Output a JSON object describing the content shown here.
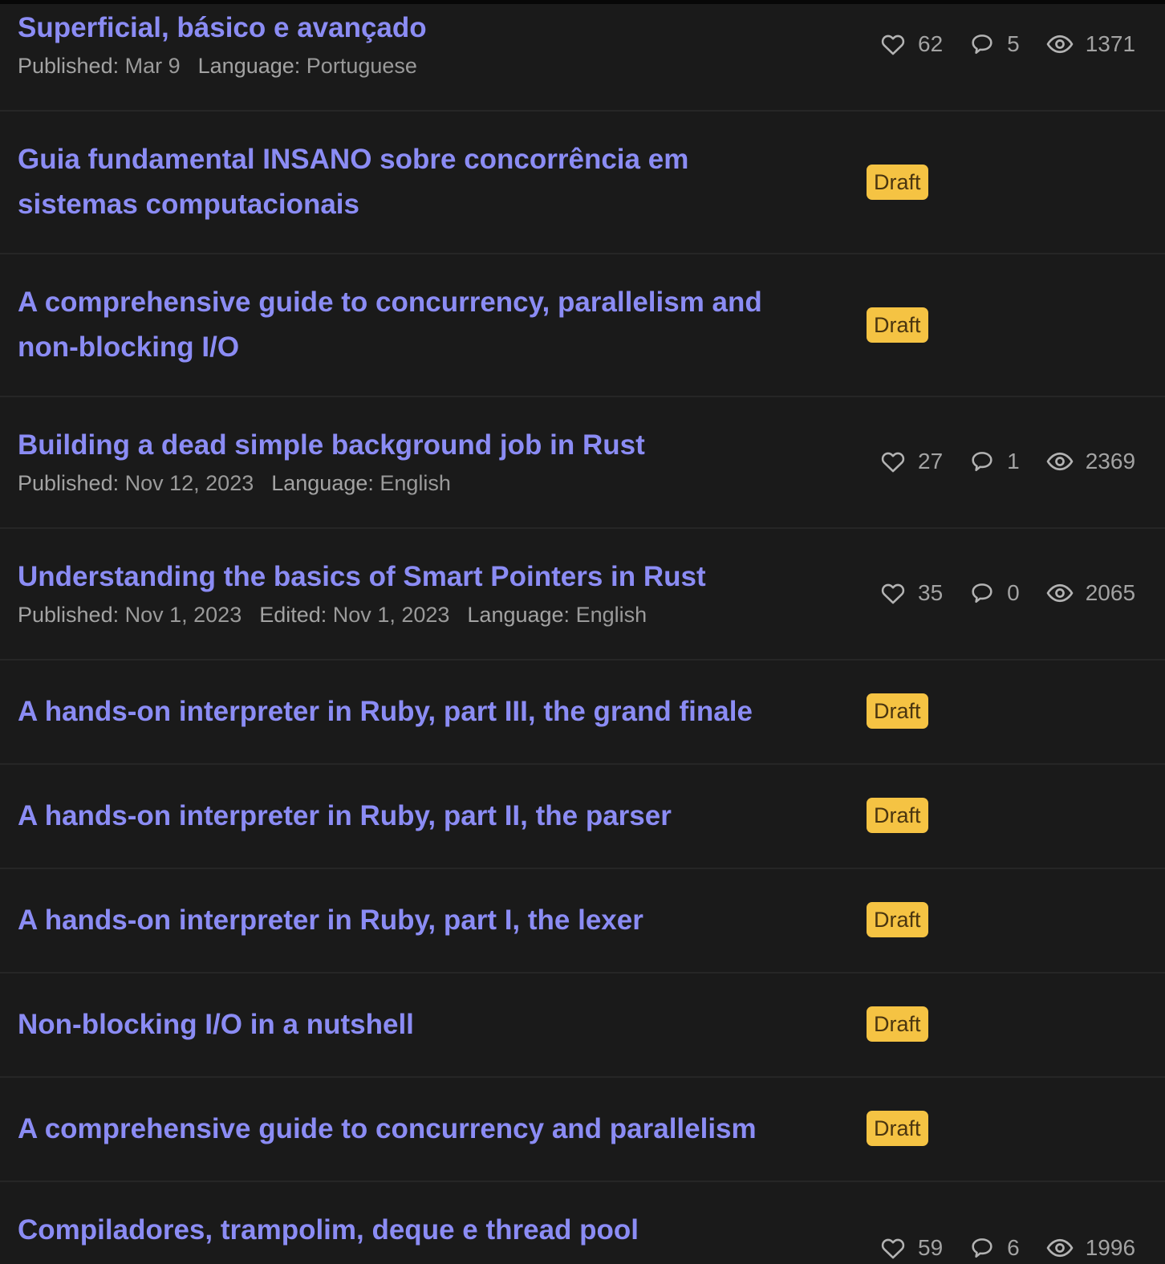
{
  "labels": {
    "published": "Published:",
    "edited": "Edited:",
    "language": "Language:"
  },
  "draft_label": "Draft",
  "colors": {
    "background": "#1a1a1a",
    "title": "#8b8cf4",
    "badge_bg": "#f5c343",
    "badge_text": "#4a3510",
    "meta": "#9a9a9a"
  },
  "icons": {
    "likes": "heart-icon",
    "comments": "comment-icon",
    "views": "eye-icon"
  },
  "articles": [
    {
      "title": "Superficial, básico e avançado",
      "published": "Mar 9",
      "language": "Portuguese",
      "likes": "62",
      "comments": "5",
      "views": "1371"
    },
    {
      "title_line1": "Guia fundamental INSANO sobre concorrência em",
      "title_line2": "sistemas computacionais",
      "status": "Draft"
    },
    {
      "title_line1": "A comprehensive guide to concurrency, parallelism and",
      "title_line2": "non-blocking I/O",
      "status": "Draft"
    },
    {
      "title": "Building a dead simple background job in Rust",
      "published": "Nov 12, 2023",
      "language": "English",
      "likes": "27",
      "comments": "1",
      "views": "2369"
    },
    {
      "title": "Understanding the basics of Smart Pointers in Rust",
      "published": "Nov 1, 2023",
      "edited": "Nov 1, 2023",
      "language": "English",
      "likes": "35",
      "comments": "0",
      "views": "2065"
    },
    {
      "title": "A hands-on interpreter in Ruby, part III, the grand finale",
      "status": "Draft"
    },
    {
      "title": "A hands-on interpreter in Ruby, part II, the parser",
      "status": "Draft"
    },
    {
      "title": "A hands-on interpreter in Ruby, part I, the lexer",
      "status": "Draft"
    },
    {
      "title": "Non-blocking I/O in a nutshell",
      "status": "Draft"
    },
    {
      "title": "A comprehensive guide to concurrency and parallelism",
      "status": "Draft"
    },
    {
      "title": "Compiladores, trampolim, deque e thread pool",
      "likes": "59",
      "comments": "6",
      "views": "1996"
    }
  ]
}
